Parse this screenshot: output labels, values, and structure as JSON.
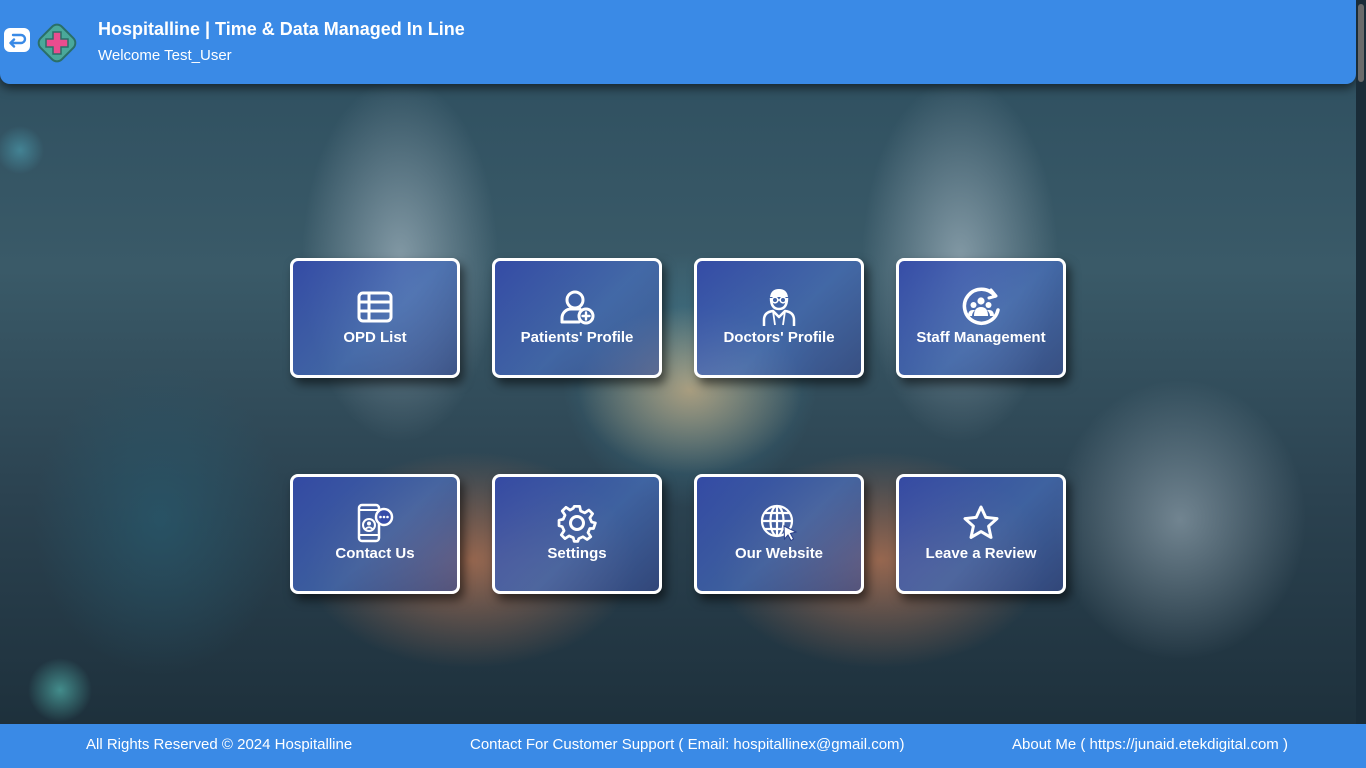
{
  "header": {
    "title": "Hospitalline | Time & Data Managed In Line",
    "welcome": "Welcome Test_User",
    "back_icon": "back-arrow-icon",
    "logo_icon": "medical-cross-logo",
    "background_color": "#3a8ae6"
  },
  "cards": [
    {
      "label": "OPD List",
      "icon": "list-icon"
    },
    {
      "label": "Patients' Profile",
      "icon": "patient-add-icon"
    },
    {
      "label": "Doctors' Profile",
      "icon": "doctor-icon"
    },
    {
      "label": "Staff Management",
      "icon": "staff-group-icon"
    },
    {
      "label": "Contact Us",
      "icon": "phone-contact-icon"
    },
    {
      "label": "Settings",
      "icon": "gear-icon"
    },
    {
      "label": "Our Website",
      "icon": "globe-icon"
    },
    {
      "label": "Leave a Review",
      "icon": "star-icon"
    }
  ],
  "footer": {
    "rights": "All Rights Reserved © 2024 Hospitalline",
    "support": "Contact For Customer Support ( Email: hospitallinex@gmail.com)",
    "about": "About Me ( https://junaid.etekdigital.com )"
  }
}
